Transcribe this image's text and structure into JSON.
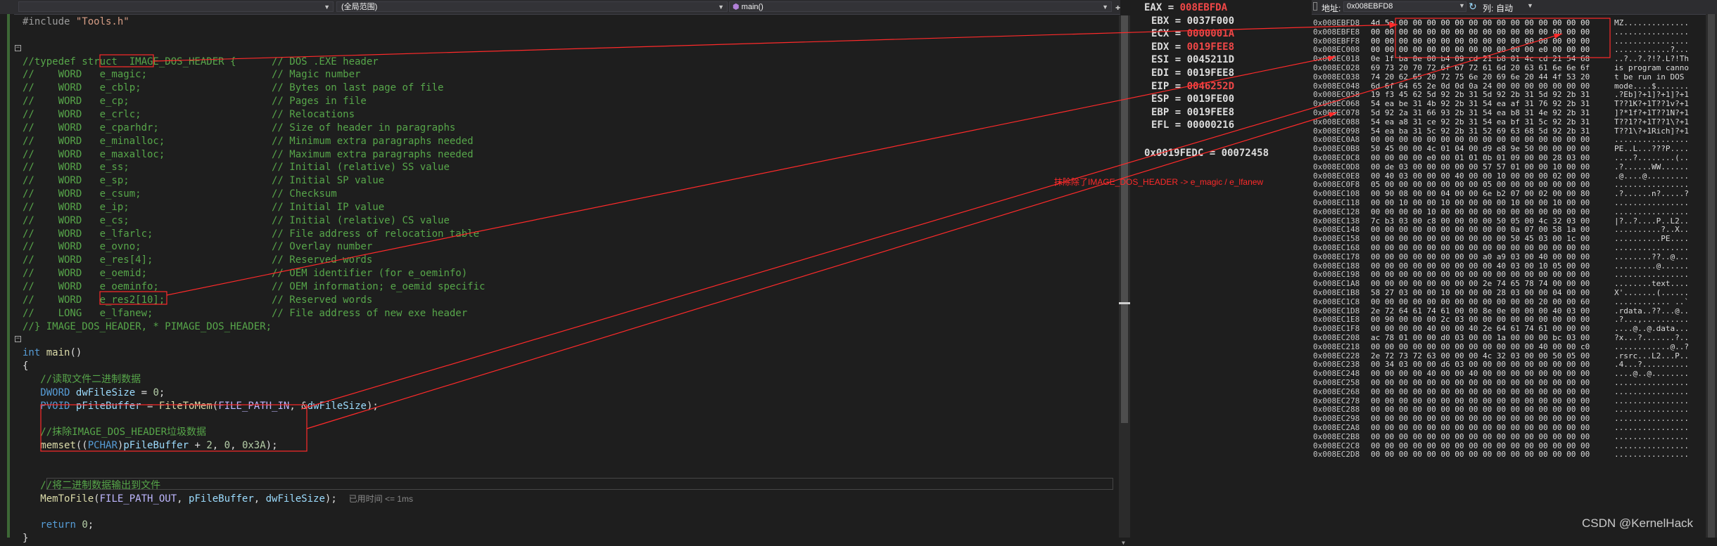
{
  "editor": {
    "scope_dropdown": "(全局范围)",
    "function_dropdown": "main()",
    "function_icon": "cube-icon",
    "left_dropdown": "",
    "split_icon": "split-plus-icon",
    "exec_hint": "已用时间 <= 1ms",
    "lines": [
      {
        "segments": [
          {
            "c": "pp",
            "t": "#include "
          },
          {
            "c": "str",
            "t": "\"Tools.h\""
          }
        ]
      },
      {
        "segments": []
      },
      {
        "segments": []
      },
      {
        "segments": [
          {
            "c": "cmt",
            "t": "//typedef struct _IMAGE_DOS_HEADER {      // DOS .EXE header"
          }
        ]
      },
      {
        "segments": [
          {
            "c": "cmt",
            "t": "//    WORD   e_magic;                     // Magic number"
          }
        ]
      },
      {
        "segments": [
          {
            "c": "cmt",
            "t": "//    WORD   e_cblp;                      // Bytes on last page of file"
          }
        ]
      },
      {
        "segments": [
          {
            "c": "cmt",
            "t": "//    WORD   e_cp;                        // Pages in file"
          }
        ]
      },
      {
        "segments": [
          {
            "c": "cmt",
            "t": "//    WORD   e_crlc;                      // Relocations"
          }
        ]
      },
      {
        "segments": [
          {
            "c": "cmt",
            "t": "//    WORD   e_cparhdr;                   // Size of header in paragraphs"
          }
        ]
      },
      {
        "segments": [
          {
            "c": "cmt",
            "t": "//    WORD   e_minalloc;                  // Minimum extra paragraphs needed"
          }
        ]
      },
      {
        "segments": [
          {
            "c": "cmt",
            "t": "//    WORD   e_maxalloc;                  // Maximum extra paragraphs needed"
          }
        ]
      },
      {
        "segments": [
          {
            "c": "cmt",
            "t": "//    WORD   e_ss;                        // Initial (relative) SS value"
          }
        ]
      },
      {
        "segments": [
          {
            "c": "cmt",
            "t": "//    WORD   e_sp;                        // Initial SP value"
          }
        ]
      },
      {
        "segments": [
          {
            "c": "cmt",
            "t": "//    WORD   e_csum;                      // Checksum"
          }
        ]
      },
      {
        "segments": [
          {
            "c": "cmt",
            "t": "//    WORD   e_ip;                        // Initial IP value"
          }
        ]
      },
      {
        "segments": [
          {
            "c": "cmt",
            "t": "//    WORD   e_cs;                        // Initial (relative) CS value"
          }
        ]
      },
      {
        "segments": [
          {
            "c": "cmt",
            "t": "//    WORD   e_lfarlc;                    // File address of relocation table"
          }
        ]
      },
      {
        "segments": [
          {
            "c": "cmt",
            "t": "//    WORD   e_ovno;                      // Overlay number"
          }
        ]
      },
      {
        "segments": [
          {
            "c": "cmt",
            "t": "//    WORD   e_res[4];                    // Reserved words"
          }
        ]
      },
      {
        "segments": [
          {
            "c": "cmt",
            "t": "//    WORD   e_oemid;                     // OEM identifier (for e_oeminfo)"
          }
        ]
      },
      {
        "segments": [
          {
            "c": "cmt",
            "t": "//    WORD   e_oeminfo;                   // OEM information; e_oemid specific"
          }
        ]
      },
      {
        "segments": [
          {
            "c": "cmt",
            "t": "//    WORD   e_res2[10];                  // Reserved words"
          }
        ]
      },
      {
        "segments": [
          {
            "c": "cmt",
            "t": "//    LONG   e_lfanew;                    // File address of new exe header"
          }
        ]
      },
      {
        "segments": [
          {
            "c": "cmt",
            "t": "//} IMAGE_DOS_HEADER, * PIMAGE_DOS_HEADER;"
          }
        ]
      },
      {
        "segments": []
      },
      {
        "segments": [
          {
            "c": "kw",
            "t": "int"
          },
          {
            "c": "",
            "t": " "
          },
          {
            "c": "fn",
            "t": "main"
          },
          {
            "c": "",
            "t": "()"
          }
        ]
      },
      {
        "segments": [
          {
            "c": "",
            "t": "{"
          }
        ]
      },
      {
        "segments": [
          {
            "c": "cmt",
            "t": "   //读取文件二进制数据"
          }
        ]
      },
      {
        "segments": [
          {
            "c": "",
            "t": "   "
          },
          {
            "c": "kw",
            "t": "DWORD"
          },
          {
            "c": "",
            "t": " "
          },
          {
            "c": "var",
            "t": "dwFileSize"
          },
          {
            "c": "",
            "t": " = "
          },
          {
            "c": "num",
            "t": "0"
          },
          {
            "c": "",
            "t": ";"
          }
        ]
      },
      {
        "segments": [
          {
            "c": "",
            "t": "   "
          },
          {
            "c": "kw",
            "t": "PVOID"
          },
          {
            "c": "",
            "t": " "
          },
          {
            "c": "var",
            "t": "pFileBuffer"
          },
          {
            "c": "",
            "t": " = "
          },
          {
            "c": "fn",
            "t": "FileToMem"
          },
          {
            "c": "",
            "t": "("
          },
          {
            "c": "mac",
            "t": "FILE_PATH_IN"
          },
          {
            "c": "",
            "t": ", &"
          },
          {
            "c": "var",
            "t": "dwFileSize"
          },
          {
            "c": "",
            "t": ");"
          }
        ]
      },
      {
        "segments": []
      },
      {
        "segments": [
          {
            "c": "cmt",
            "t": "   //抹除IMAGE_DOS_HEADER垃圾数据"
          }
        ]
      },
      {
        "segments": [
          {
            "c": "",
            "t": "   "
          },
          {
            "c": "fn",
            "t": "memset"
          },
          {
            "c": "",
            "t": "(("
          },
          {
            "c": "kw",
            "t": "PCHAR"
          },
          {
            "c": "",
            "t": ")"
          },
          {
            "c": "var",
            "t": "pFileBuffer"
          },
          {
            "c": "",
            "t": " + "
          },
          {
            "c": "num",
            "t": "2"
          },
          {
            "c": "",
            "t": ", "
          },
          {
            "c": "num",
            "t": "0"
          },
          {
            "c": "",
            "t": ", "
          },
          {
            "c": "num",
            "t": "0x3A"
          },
          {
            "c": "",
            "t": ");"
          }
        ]
      },
      {
        "segments": []
      },
      {
        "segments": []
      },
      {
        "segments": [
          {
            "c": "cmt",
            "t": "   //将二进制数据输出到文件"
          }
        ]
      },
      {
        "segments": [
          {
            "c": "",
            "t": "   "
          },
          {
            "c": "fn",
            "t": "MemToFile"
          },
          {
            "c": "",
            "t": "("
          },
          {
            "c": "mac",
            "t": "FILE_PATH_OUT"
          },
          {
            "c": "",
            "t": ", "
          },
          {
            "c": "var",
            "t": "pFileBuffer"
          },
          {
            "c": "",
            "t": ", "
          },
          {
            "c": "var",
            "t": "dwFileSize"
          },
          {
            "c": "",
            "t": ");"
          }
        ]
      },
      {
        "segments": []
      },
      {
        "segments": [
          {
            "c": "",
            "t": "   "
          },
          {
            "c": "kw",
            "t": "return"
          },
          {
            "c": "",
            "t": " "
          },
          {
            "c": "num",
            "t": "0"
          },
          {
            "c": "",
            "t": ";"
          }
        ]
      },
      {
        "segments": [
          {
            "c": "",
            "t": "}"
          }
        ]
      }
    ]
  },
  "registers": {
    "items": [
      {
        "name": "EAX",
        "value": "008EBFDA",
        "changed": true
      },
      {
        "name": "EBX",
        "value": "0037F000",
        "changed": false
      },
      {
        "name": "ECX",
        "value": "0000001A",
        "changed": true
      },
      {
        "name": "EDX",
        "value": "0019FEE8",
        "changed": true
      },
      {
        "name": "ESI",
        "value": "0045211D",
        "changed": false
      },
      {
        "name": "EDI",
        "value": "0019FEE8",
        "changed": false
      },
      {
        "name": "EIP",
        "value": "0046252D",
        "changed": true
      },
      {
        "name": "ESP",
        "value": "0019FE00",
        "changed": false
      },
      {
        "name": "EBP",
        "value": "0019FEE8",
        "changed": false
      },
      {
        "name": "EFL",
        "value": "00000216",
        "changed": false
      }
    ],
    "extra": "0x0019FEDC = 00072458"
  },
  "memory": {
    "address_label": "地址:",
    "address_value": "0x008EBFD8",
    "columns_label": "列:",
    "columns_value": "自动",
    "refresh_icon": "refresh-icon",
    "rows": [
      {
        "addr": "0x008EBFD8",
        "hex": "4d 5a 00 00 00 00 00 00 00 00 00 00 00 00 00 00",
        "ascii": "MZ.............."
      },
      {
        "addr": "0x008EBFE8",
        "hex": "00 00 00 00 00 00 00 00 00 00 00 00 00 00 00 00",
        "ascii": "................"
      },
      {
        "addr": "0x008EBFF8",
        "hex": "00 00 00 00 00 00 00 00 00 00 00 00 00 00 00 00",
        "ascii": "................"
      },
      {
        "addr": "0x008EC008",
        "hex": "00 00 00 00 00 00 00 00 00 00 00 00 e0 00 00 00",
        "ascii": "............?..."
      },
      {
        "addr": "0x008EC018",
        "hex": "0e 1f ba 0e 00 b4 09 cd 21 b8 01 4c cd 21 54 68",
        "ascii": "..?..?.?!?.L?!Th"
      },
      {
        "addr": "0x008EC028",
        "hex": "69 73 20 70 72 6f 67 72 61 6d 20 63 61 6e 6e 6f",
        "ascii": "is program canno"
      },
      {
        "addr": "0x008EC038",
        "hex": "74 20 62 65 20 72 75 6e 20 69 6e 20 44 4f 53 20",
        "ascii": "t be run in DOS "
      },
      {
        "addr": "0x008EC048",
        "hex": "6d 6f 64 65 2e 0d 0d 0a 24 00 00 00 00 00 00 00",
        "ascii": "mode....$......."
      },
      {
        "addr": "0x008EC058",
        "hex": "19 f3 45 62 5d 92 2b 31 5d 92 2b 31 5d 92 2b 31",
        "ascii": ".?Eb]?+1]?+1]?+1"
      },
      {
        "addr": "0x008EC068",
        "hex": "54 ea be 31 4b 92 2b 31 54 ea af 31 76 92 2b 31",
        "ascii": "T??1K?+1T??1v?+1"
      },
      {
        "addr": "0x008EC078",
        "hex": "5d 92 2a 31 66 93 2b 31 54 ea b8 31 4e 92 2b 31",
        "ascii": "]?*1f?+1T??1N?+1"
      },
      {
        "addr": "0x008EC088",
        "hex": "54 ea a8 31 ce 92 2b 31 54 ea bf 31 5c 92 2b 31",
        "ascii": "T??1??+1T??1\\?+1"
      },
      {
        "addr": "0x008EC098",
        "hex": "54 ea ba 31 5c 92 2b 31 52 69 63 68 5d 92 2b 31",
        "ascii": "T??1\\?+1Rich]?+1"
      },
      {
        "addr": "0x008EC0A8",
        "hex": "00 00 00 00 00 00 00 00 00 00 00 00 00 00 00 00",
        "ascii": "................"
      },
      {
        "addr": "0x008EC0B8",
        "hex": "50 45 00 00 4c 01 04 00 d9 e8 9e 50 00 00 00 00",
        "ascii": "PE..L...???P...."
      },
      {
        "addr": "0x008EC0C8",
        "hex": "00 00 00 00 e0 00 01 01 0b 01 09 00 00 28 03 00",
        "ascii": "....?........(.."
      },
      {
        "addr": "0x008EC0D8",
        "hex": "00 de 03 00 00 00 00 00 57 57 01 00 00 10 00 00",
        "ascii": ".?......WW......"
      },
      {
        "addr": "0x008EC0E8",
        "hex": "00 40 03 00 00 00 40 00 00 10 00 00 00 02 00 00",
        "ascii": ".@....@........."
      },
      {
        "addr": "0x008EC0F8",
        "hex": "05 00 00 00 00 00 00 00 05 00 00 00 00 00 00 00",
        "ascii": "................"
      },
      {
        "addr": "0x008EC108",
        "hex": "00 90 08 00 00 04 00 00 6e b2 07 00 02 00 00 80",
        "ascii": ".?......n?.....?"
      },
      {
        "addr": "0x008EC118",
        "hex": "00 00 10 00 00 10 00 00 00 00 10 00 00 10 00 00",
        "ascii": "................"
      },
      {
        "addr": "0x008EC128",
        "hex": "00 00 00 00 10 00 00 00 00 00 00 00 00 00 00 00",
        "ascii": "................"
      },
      {
        "addr": "0x008EC138",
        "hex": "7c b3 03 00 c8 00 00 00 00 50 05 00 4c 32 03 00",
        "ascii": "|?..?....P..L2.."
      },
      {
        "addr": "0x008EC148",
        "hex": "00 00 00 00 00 00 00 00 00 00 0a 07 00 58 1a 00",
        "ascii": "..........?..X.."
      },
      {
        "addr": "0x008EC158",
        "hex": "00 00 00 00 00 00 00 00 00 00 50 45 03 00 1c 00",
        "ascii": "..........PE...."
      },
      {
        "addr": "0x008EC168",
        "hex": "00 00 00 00 00 00 00 00 00 00 00 00 00 00 00 00",
        "ascii": "................"
      },
      {
        "addr": "0x008EC178",
        "hex": "00 00 00 00 00 00 00 00 a0 a9 03 00 40 00 00 00",
        "ascii": "........??..@..."
      },
      {
        "addr": "0x008EC188",
        "hex": "00 00 00 00 00 00 00 00 00 40 03 00 10 05 00 00",
        "ascii": ".........@......"
      },
      {
        "addr": "0x008EC198",
        "hex": "00 00 00 00 00 00 00 00 00 00 00 00 00 00 00 00",
        "ascii": "................"
      },
      {
        "addr": "0x008EC1A8",
        "hex": "00 00 00 00 00 00 00 00 2e 74 65 78 74 00 00 00",
        "ascii": "........text...."
      },
      {
        "addr": "0x008EC1B8",
        "hex": "58 27 03 00 00 10 00 00 00 28 03 00 00 04 00 00",
        "ascii": "X'.......(......"
      },
      {
        "addr": "0x008EC1C8",
        "hex": "00 00 00 00 00 00 00 00 00 00 00 00 20 00 00 60",
        "ascii": "............ ..`"
      },
      {
        "addr": "0x008EC1D8",
        "hex": "2e 72 64 61 74 61 00 00 8e 0e 00 00 00 40 03 00",
        "ascii": ".rdata..??...@.."
      },
      {
        "addr": "0x008EC1E8",
        "hex": "00 90 00 00 00 2c 03 00 00 00 00 00 00 00 00 00",
        "ascii": ".?...,.........."
      },
      {
        "addr": "0x008EC1F8",
        "hex": "00 00 00 00 40 00 00 40 2e 64 61 74 61 00 00 00",
        "ascii": "....@..@.data..."
      },
      {
        "addr": "0x008EC208",
        "hex": "ac 78 01 00 00 d0 03 00 00 1a 00 00 00 bc 03 00",
        "ascii": "?x...?.......?.."
      },
      {
        "addr": "0x008EC218",
        "hex": "00 00 00 00 00 00 00 00 00 00 00 00 40 00 00 c0",
        "ascii": "............@..?"
      },
      {
        "addr": "0x008EC228",
        "hex": "2e 72 73 72 63 00 00 00 4c 32 03 00 00 50 05 00",
        "ascii": ".rsrc...L2...P.."
      },
      {
        "addr": "0x008EC238",
        "hex": "00 34 03 00 00 d6 03 00 00 00 00 00 00 00 00 00",
        "ascii": ".4...?.........."
      },
      {
        "addr": "0x008EC248",
        "hex": "00 00 00 00 40 00 00 40 00 00 00 00 00 00 00 00",
        "ascii": "....@..@........"
      },
      {
        "addr": "0x008EC258",
        "hex": "00 00 00 00 00 00 00 00 00 00 00 00 00 00 00 00",
        "ascii": "................"
      },
      {
        "addr": "0x008EC268",
        "hex": "00 00 00 00 00 00 00 00 00 00 00 00 00 00 00 00",
        "ascii": "................"
      },
      {
        "addr": "0x008EC278",
        "hex": "00 00 00 00 00 00 00 00 00 00 00 00 00 00 00 00",
        "ascii": "................"
      },
      {
        "addr": "0x008EC288",
        "hex": "00 00 00 00 00 00 00 00 00 00 00 00 00 00 00 00",
        "ascii": "................"
      },
      {
        "addr": "0x008EC298",
        "hex": "00 00 00 00 00 00 00 00 00 00 00 00 00 00 00 00",
        "ascii": "................"
      },
      {
        "addr": "0x008EC2A8",
        "hex": "00 00 00 00 00 00 00 00 00 00 00 00 00 00 00 00",
        "ascii": "................"
      },
      {
        "addr": "0x008EC2B8",
        "hex": "00 00 00 00 00 00 00 00 00 00 00 00 00 00 00 00",
        "ascii": "................"
      },
      {
        "addr": "0x008EC2C8",
        "hex": "00 00 00 00 00 00 00 00 00 00 00 00 00 00 00 00",
        "ascii": "................"
      },
      {
        "addr": "0x008EC2D8",
        "hex": "00 00 00 00 00 00 00 00 00 00 00 00 00 00 00 00",
        "ascii": "................"
      }
    ]
  },
  "annotation": {
    "note": "抹除除了IMAGE_DOS_HEADER -> e_magic / e_lfanew",
    "color": "#ff2a2a"
  },
  "watermark": "CSDN @KernelHack",
  "colors": {
    "changed_value": "#f04747",
    "comment": "#57a64a",
    "keyword": "#569cd6"
  }
}
